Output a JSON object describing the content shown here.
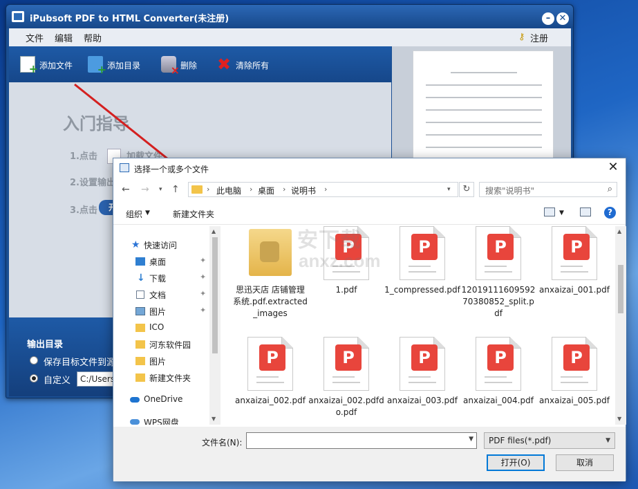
{
  "app": {
    "title": "iPubsoft PDF to HTML Converter(未注册)",
    "menu": [
      "文件",
      "编辑",
      "帮助"
    ],
    "register": "注册",
    "toolbar": [
      "添加文件",
      "添加目录",
      "删除",
      "清除所有"
    ],
    "guide_title": "入门指导",
    "steps": [
      "1.点击",
      "加载文件",
      "2.设置输出",
      "3.点击"
    ],
    "step_button": "开",
    "output_title": "输出目录",
    "radio_save_source": "保存目标文件到源",
    "radio_custom": "自定义",
    "custom_path": "C:/Users"
  },
  "dialog": {
    "title": "选择一个或多个文件",
    "breadcrumb": [
      "此电脑",
      "桌面",
      "说明书"
    ],
    "search_placeholder": "搜索\"说明书\"",
    "organize": "组织",
    "new_folder": "新建文件夹",
    "tree": [
      {
        "label": "快速访问",
        "icon": "star-icon"
      },
      {
        "label": "桌面",
        "icon": "desktop-icon",
        "pinned": true
      },
      {
        "label": "下载",
        "icon": "download-icon",
        "pinned": true
      },
      {
        "label": "文档",
        "icon": "documents-icon",
        "pinned": true
      },
      {
        "label": "图片",
        "icon": "pictures-icon",
        "pinned": true
      },
      {
        "label": "ICO",
        "icon": "folder-icon"
      },
      {
        "label": "河东软件园",
        "icon": "folder-icon"
      },
      {
        "label": "图片",
        "icon": "folder-icon"
      },
      {
        "label": "新建文件夹",
        "icon": "folder-icon"
      },
      {
        "label": "OneDrive",
        "icon": "onedrive-icon"
      },
      {
        "label": "WPS网盘",
        "icon": "wps-cloud-icon"
      }
    ],
    "files": [
      {
        "name": "思迅天店 店铺管理系统.pdf.extracted_images",
        "kind": "folder"
      },
      {
        "name": "1.pdf",
        "kind": "pdf"
      },
      {
        "name": "1_compressed.pdf",
        "kind": "pdf"
      },
      {
        "name": "1201911160959270380852_split.pdf",
        "kind": "pdf"
      },
      {
        "name": "anxaizai_001.pdf",
        "kind": "pdf"
      },
      {
        "name": "anxaizai_002.pdf",
        "kind": "pdf"
      },
      {
        "name": "anxaizai_002.pdfdo.pdf",
        "kind": "pdf"
      },
      {
        "name": "anxaizai_003.pdf",
        "kind": "pdf"
      },
      {
        "name": "anxaizai_004.pdf",
        "kind": "pdf"
      },
      {
        "name": "anxaizai_005.pdf",
        "kind": "pdf"
      }
    ],
    "filename_label": "文件名(N):",
    "filename_value": "",
    "filetype": "PDF files(*.pdf)",
    "open_button": "打开(O)",
    "cancel_button": "取消"
  },
  "watermark": {
    "text": "安下载",
    "sub": "anxz.com"
  },
  "colors": {
    "accent": "#1a4f93",
    "pdf_red": "#e8453c",
    "arrow": "#d42020"
  }
}
